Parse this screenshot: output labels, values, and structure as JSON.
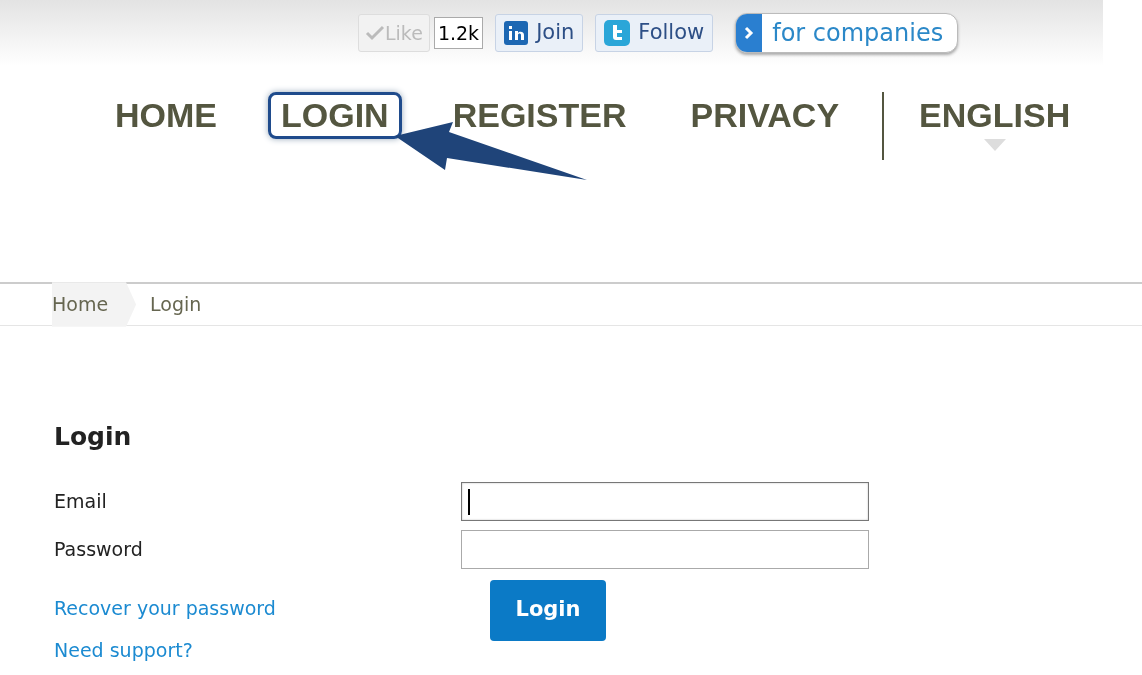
{
  "social": {
    "like": {
      "label": "Like",
      "count": "1.2k"
    },
    "join": "Join",
    "follow": "Follow",
    "companies": "for companies"
  },
  "nav": [
    {
      "label": "HOME",
      "highlighted": false
    },
    {
      "label": "LOGIN",
      "highlighted": true
    },
    {
      "label": "REGISTER",
      "highlighted": false
    },
    {
      "label": "PRIVACY",
      "highlighted": false
    }
  ],
  "language": "ENGLISH",
  "breadcrumb": [
    "Home",
    "Login"
  ],
  "form": {
    "title": "Login",
    "fields": [
      {
        "label": "Email",
        "focused": true
      },
      {
        "label": "Password",
        "focused": false
      }
    ],
    "links": [
      "Recover your password",
      "Need support?"
    ],
    "submit": "Login"
  }
}
